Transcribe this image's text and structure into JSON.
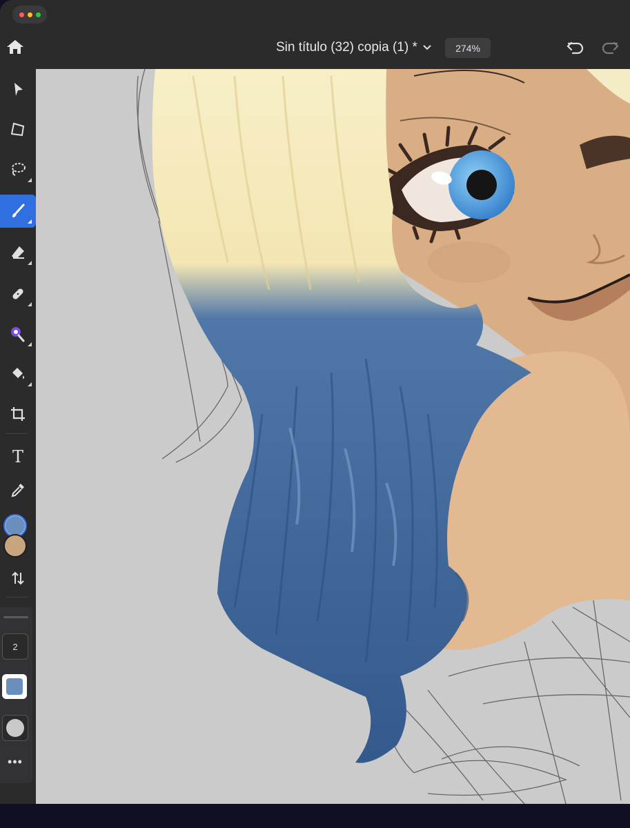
{
  "window": {
    "traffic_colors": [
      "#ff5f57",
      "#febc2e",
      "#28c840"
    ]
  },
  "header": {
    "document_title": "Sin título (32) copia (1) *",
    "zoom_level": "274%",
    "icons": [
      "home-icon",
      "chevron-down-icon",
      "undo-icon",
      "redo-icon"
    ]
  },
  "toolbar": {
    "tools": [
      {
        "name": "select",
        "icon": "arrow-pointer-icon"
      },
      {
        "name": "transform",
        "icon": "transform-icon"
      },
      {
        "name": "lasso",
        "icon": "lasso-icon"
      },
      {
        "name": "brush",
        "icon": "brush-icon",
        "active": true
      },
      {
        "name": "eraser",
        "icon": "eraser-icon"
      },
      {
        "name": "healing",
        "icon": "bandage-icon"
      },
      {
        "name": "quick-select",
        "icon": "magic-wand-icon"
      },
      {
        "name": "fill",
        "icon": "paint-bucket-icon"
      },
      {
        "name": "crop",
        "icon": "crop-icon"
      },
      {
        "name": "type",
        "icon": "text-icon",
        "glyph": "T"
      },
      {
        "name": "eyedropper",
        "icon": "eyedropper-icon"
      }
    ],
    "primary_color": "#6a8fbd",
    "secondary_color": "#c7a67f",
    "swap_icon": "swap-arrows-icon"
  },
  "brush_panel": {
    "size": "2",
    "color": "#6a8fbd",
    "tip_shape": "round-icon",
    "more_label": "•••"
  },
  "canvas": {
    "background": "#cbcbcb",
    "artwork": "illustration-blonde-blue-hair"
  }
}
